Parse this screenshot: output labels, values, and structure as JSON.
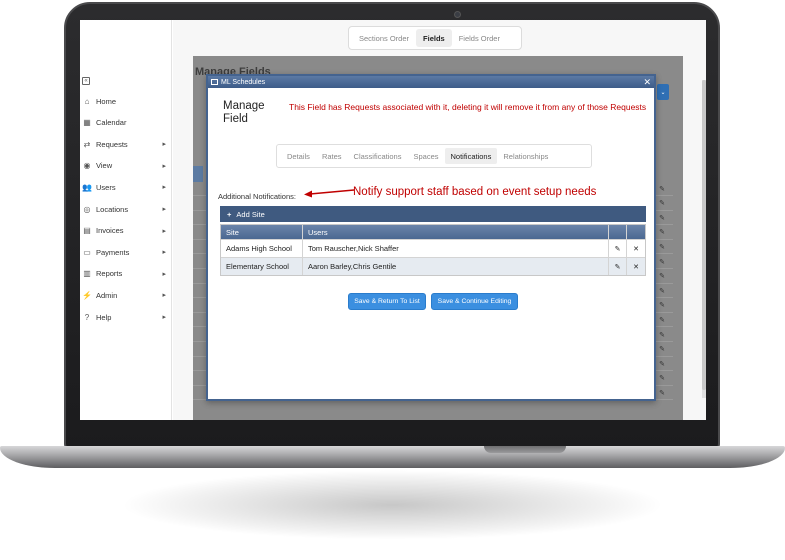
{
  "sidebar": {
    "items": [
      {
        "label": "Home",
        "icon": "home-icon",
        "glyph": "⌂",
        "chevron": false
      },
      {
        "label": "Calendar",
        "icon": "calendar-icon",
        "glyph": "▦",
        "chevron": false
      },
      {
        "label": "Requests",
        "icon": "requests-icon",
        "glyph": "⇄",
        "chevron": true
      },
      {
        "label": "View",
        "icon": "view-icon",
        "glyph": "◉",
        "chevron": true
      },
      {
        "label": "Users",
        "icon": "users-icon",
        "glyph": "👥",
        "chevron": true
      },
      {
        "label": "Locations",
        "icon": "location-icon",
        "glyph": "◎",
        "chevron": true
      },
      {
        "label": "Invoices",
        "icon": "invoice-icon",
        "glyph": "▤",
        "chevron": true
      },
      {
        "label": "Payments",
        "icon": "payments-icon",
        "glyph": "▭",
        "chevron": true
      },
      {
        "label": "Reports",
        "icon": "reports-icon",
        "glyph": "▥",
        "chevron": true
      },
      {
        "label": "Admin",
        "icon": "admin-icon",
        "glyph": "⚡",
        "chevron": true
      },
      {
        "label": "Help",
        "icon": "help-icon",
        "glyph": "?",
        "chevron": true
      }
    ]
  },
  "view_tabs": {
    "sections": "Sections Order",
    "fields": "Fields",
    "fields_order": "Fields Order"
  },
  "background": {
    "title": "Manage Fields"
  },
  "modal": {
    "window_title": "ML Schedules",
    "title": "Manage Field",
    "warning": "This Field has Requests associated with it, deleting it will remove it from any of those Requests",
    "tabs": [
      "Details",
      "Rates",
      "Classifications",
      "Spaces",
      "Notifications",
      "Relationships"
    ],
    "active_tab": "Notifications",
    "additional_label": "Additional Notifications:",
    "annotation": "Notify support staff based on event setup needs",
    "add_site": "Add Site",
    "grid": {
      "headers": {
        "site": "Site",
        "users": "Users"
      },
      "rows": [
        {
          "site": "Adams High School",
          "users": "Tom Rauscher,Nick Shaffer"
        },
        {
          "site": "Elementary School",
          "users": "Aaron Barley,Chris Gentile"
        }
      ]
    },
    "buttons": {
      "save_return": "Save & Return To List",
      "save_continue": "Save & Continue Editing"
    }
  },
  "colors": {
    "accent": "#3b8fe0",
    "header": "#3f5a80",
    "warning": "#c00000"
  }
}
